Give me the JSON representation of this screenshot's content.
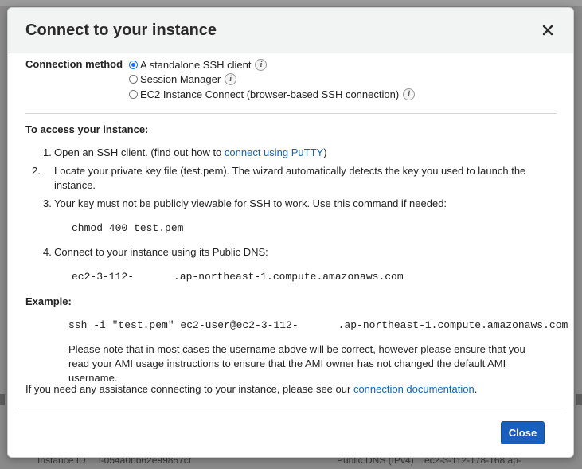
{
  "background": {
    "instance_id_label": "Instance ID",
    "instance_id_value": "i-054a0bb62e99857cf",
    "public_dns_label": "Public DNS (IPv4)",
    "public_dns_value": "ec2-3-112-178-168.ap-"
  },
  "modal": {
    "title": "Connect to your instance",
    "connection_method": {
      "label": "Connection method",
      "options": [
        {
          "label": "A standalone SSH client",
          "selected": true
        },
        {
          "label": "Session Manager",
          "selected": false
        },
        {
          "label": "EC2 Instance Connect (browser-based SSH connection)",
          "selected": false
        }
      ]
    },
    "access_heading": "To access your instance:",
    "steps": {
      "s1_num": "1.",
      "s1_text": "Open an SSH client. (find out how to ",
      "s1_link": "connect using PuTTY",
      "s1_after": ")",
      "s2_num": "2.",
      "s2_text": "Locate your private key file (test.pem). The wizard automatically detects the key you used to launch the instance.",
      "s3_num": "3.",
      "s3_text": "Your key must not be publicly viewable for SSH to work. Use this command if needed:",
      "s3_command": "chmod 400 test.pem",
      "s4_num": "4.",
      "s4_text": "Connect to your instance using its Public DNS:",
      "s4_dns_prefix": "ec2-3-112-",
      "s4_dns_suffix": ".ap-northeast-1.compute.amazonaws.com"
    },
    "example_heading": "Example:",
    "example_cmd_prefix": "ssh -i \"test.pem\" ec2-user@ec2-3-112-",
    "example_cmd_suffix": ".ap-northeast-1.compute.amazonaws.com",
    "note": "Please note that in most cases the username above will be correct, however please ensure that you read your AMI usage instructions to ensure that the AMI owner has not changed the default AMI username.",
    "assist_text": "If you need any assistance connecting to your instance, please see our ",
    "assist_link": "connection documentation",
    "assist_after": ".",
    "close_button": "Close"
  },
  "colors": {
    "primary_button": "#1b5fbd",
    "link": "#1166bb",
    "radio_selected": "#1a73e8"
  }
}
